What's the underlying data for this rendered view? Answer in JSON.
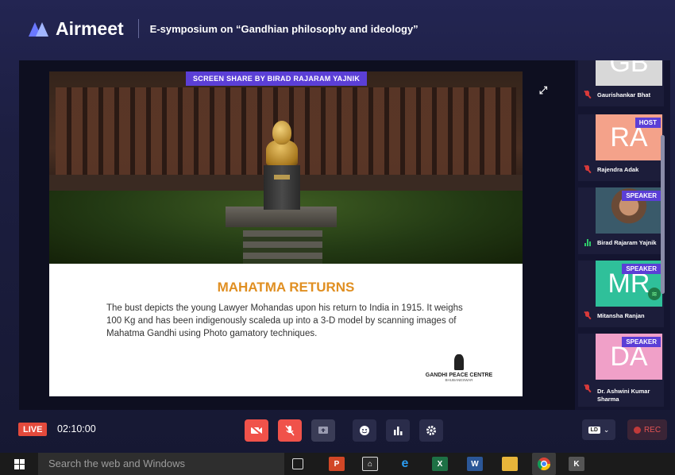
{
  "header": {
    "app_name": "Airmeet",
    "event_title": "E-symposium on “Gandhian philosophy and ideology”"
  },
  "stage": {
    "screen_share_banner": "SCREEN SHARE BY BIRAD RAJARAM YAJNIK",
    "slide": {
      "title": "MAHATMA RETURNS",
      "body": "The bust depicts the young Lawyer Mohandas upon his return to India in 1915. It weighs 100 Kg and has been indigenously scaleda up into a 3-D model by scanning images of Mahatma Gandhi using Photo gamatory techniques.",
      "logo_name": "GANDHI PEACE CENTRE",
      "logo_sub": "BHUBANESWAR"
    }
  },
  "participants": [
    {
      "initials": "GB",
      "name": "Gaurishankar Bhat",
      "badge": "",
      "avatar_color": "#d8d8d8",
      "mic": "muted"
    },
    {
      "initials": "RA",
      "name": "Rajendra Adak",
      "badge": "HOST",
      "avatar_color": "#f4a28a",
      "mic": "muted"
    },
    {
      "initials": "",
      "name": "Birad Rajaram Yajnik",
      "badge": "SPEAKER",
      "avatar_color": "#8a6a4e",
      "mic": "speaking"
    },
    {
      "initials": "MR",
      "name": "Mitansha Ranjan",
      "badge": "SPEAKER",
      "avatar_color": "#2fc09a",
      "mic": "muted"
    },
    {
      "initials": "DA",
      "name": "Dr. Ashwini Kumar Sharma",
      "badge": "SPEAKER",
      "avatar_color": "#f0a0c8",
      "mic": "muted"
    }
  ],
  "controls": {
    "live_label": "LIVE",
    "timer": "02:10:00",
    "video_quality": "LD",
    "record_label": "REC",
    "icons": [
      "camera-off-icon",
      "mic-off-icon",
      "share-screen-icon",
      "emoji-icon",
      "poll-icon",
      "settings-icon"
    ]
  },
  "taskbar": {
    "search_placeholder": "Search the web and Windows"
  },
  "colors": {
    "accent": "#5b3fd6",
    "live": "#e44a3c",
    "slide_title": "#e08f22"
  }
}
